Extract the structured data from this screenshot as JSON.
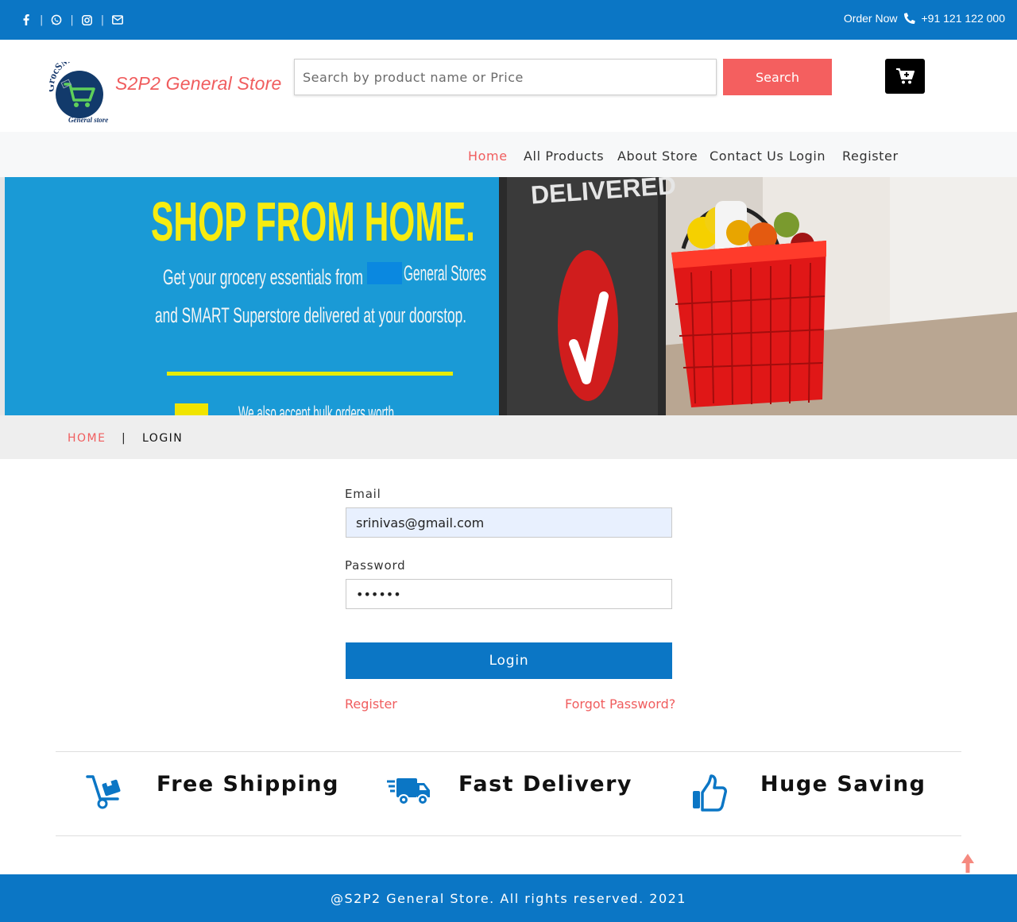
{
  "topbar": {
    "social": [
      {
        "icon": "facebook-icon"
      },
      {
        "icon": "whatsapp-icon"
      },
      {
        "icon": "instagram-icon"
      },
      {
        "icon": "mail-icon"
      }
    ],
    "order_label": "Order Now",
    "phone": "+91 121 122 000",
    "bg_color": "#0b76c5"
  },
  "header": {
    "logo": {
      "top_text": "GrocSMART",
      "bottom_text": "General store"
    },
    "brand": "S2P2 General Store",
    "search": {
      "placeholder": "Search by product name or Price",
      "value": ""
    },
    "search_button": "Search",
    "cart_icon": "cart-icon"
  },
  "nav": {
    "items": [
      {
        "label": "Home",
        "active": true
      },
      {
        "label": "All Products",
        "active": false
      },
      {
        "label": "About Store",
        "active": false
      },
      {
        "label": "Contact Us",
        "active": false
      },
      {
        "label": "Login",
        "active": false
      },
      {
        "label": "Register",
        "active": false
      }
    ]
  },
  "banner": {
    "headline": "SHOP FROM HOME.",
    "line1": "Get your grocery essentials from",
    "line1b": "General Stores",
    "line2": "and SMART Superstore delivered at your doorstop.",
    "line3": "We also accept bulk orders worth",
    "sign": "DELIVERED"
  },
  "breadcrumb": {
    "home": "HOME",
    "separator": "|",
    "current": "LOGIN"
  },
  "login": {
    "email_label": "Email",
    "email_value": "srinivas@gmail.com",
    "password_label": "Password",
    "password_value": "••••••",
    "submit": "Login",
    "register_link": "Register",
    "forgot_link": "Forgot Password?"
  },
  "features": [
    {
      "icon": "hand-truck-icon",
      "label": "Free Shipping"
    },
    {
      "icon": "delivery-truck-icon",
      "label": "Fast Delivery"
    },
    {
      "icon": "thumbs-up-icon",
      "label": "Huge Saving"
    }
  ],
  "footer": {
    "text": "@S2P2 General Store. All rights reserved. 2021"
  },
  "colors": {
    "primary": "#0b76c5",
    "accent": "#f05d5e",
    "search_button": "#f45f5f"
  }
}
